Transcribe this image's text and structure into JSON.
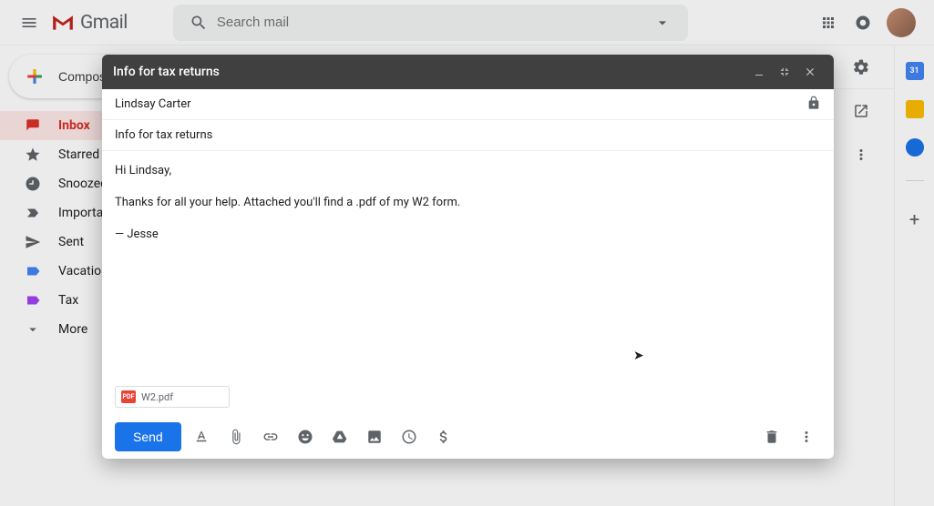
{
  "header": {
    "logo_text": "Gmail",
    "search_placeholder": "Search mail"
  },
  "compose_button": "Compose",
  "sidebar": {
    "items": [
      {
        "label": "Inbox",
        "icon": "inbox",
        "active": true
      },
      {
        "label": "Starred",
        "icon": "star"
      },
      {
        "label": "Snoozed",
        "icon": "clock"
      },
      {
        "label": "Important",
        "icon": "important"
      },
      {
        "label": "Sent",
        "icon": "sent"
      },
      {
        "label": "Vacation",
        "icon": "label-vacation"
      },
      {
        "label": "Tax",
        "icon": "label-tax"
      },
      {
        "label": "More",
        "icon": "expand"
      }
    ]
  },
  "right_panel": {
    "calendar_day": "31"
  },
  "compose_dialog": {
    "title": "Info for tax returns",
    "to": "Lindsay Carter",
    "subject": "Info for tax returns",
    "body_greeting": "Hi Lindsay,",
    "body_text": "Thanks for all your help. Attached you'll find a .pdf of my W2 form.",
    "body_signature": "— Jesse",
    "attachment": {
      "badge": "PDF",
      "name": "W2.pdf"
    },
    "send_label": "Send"
  }
}
